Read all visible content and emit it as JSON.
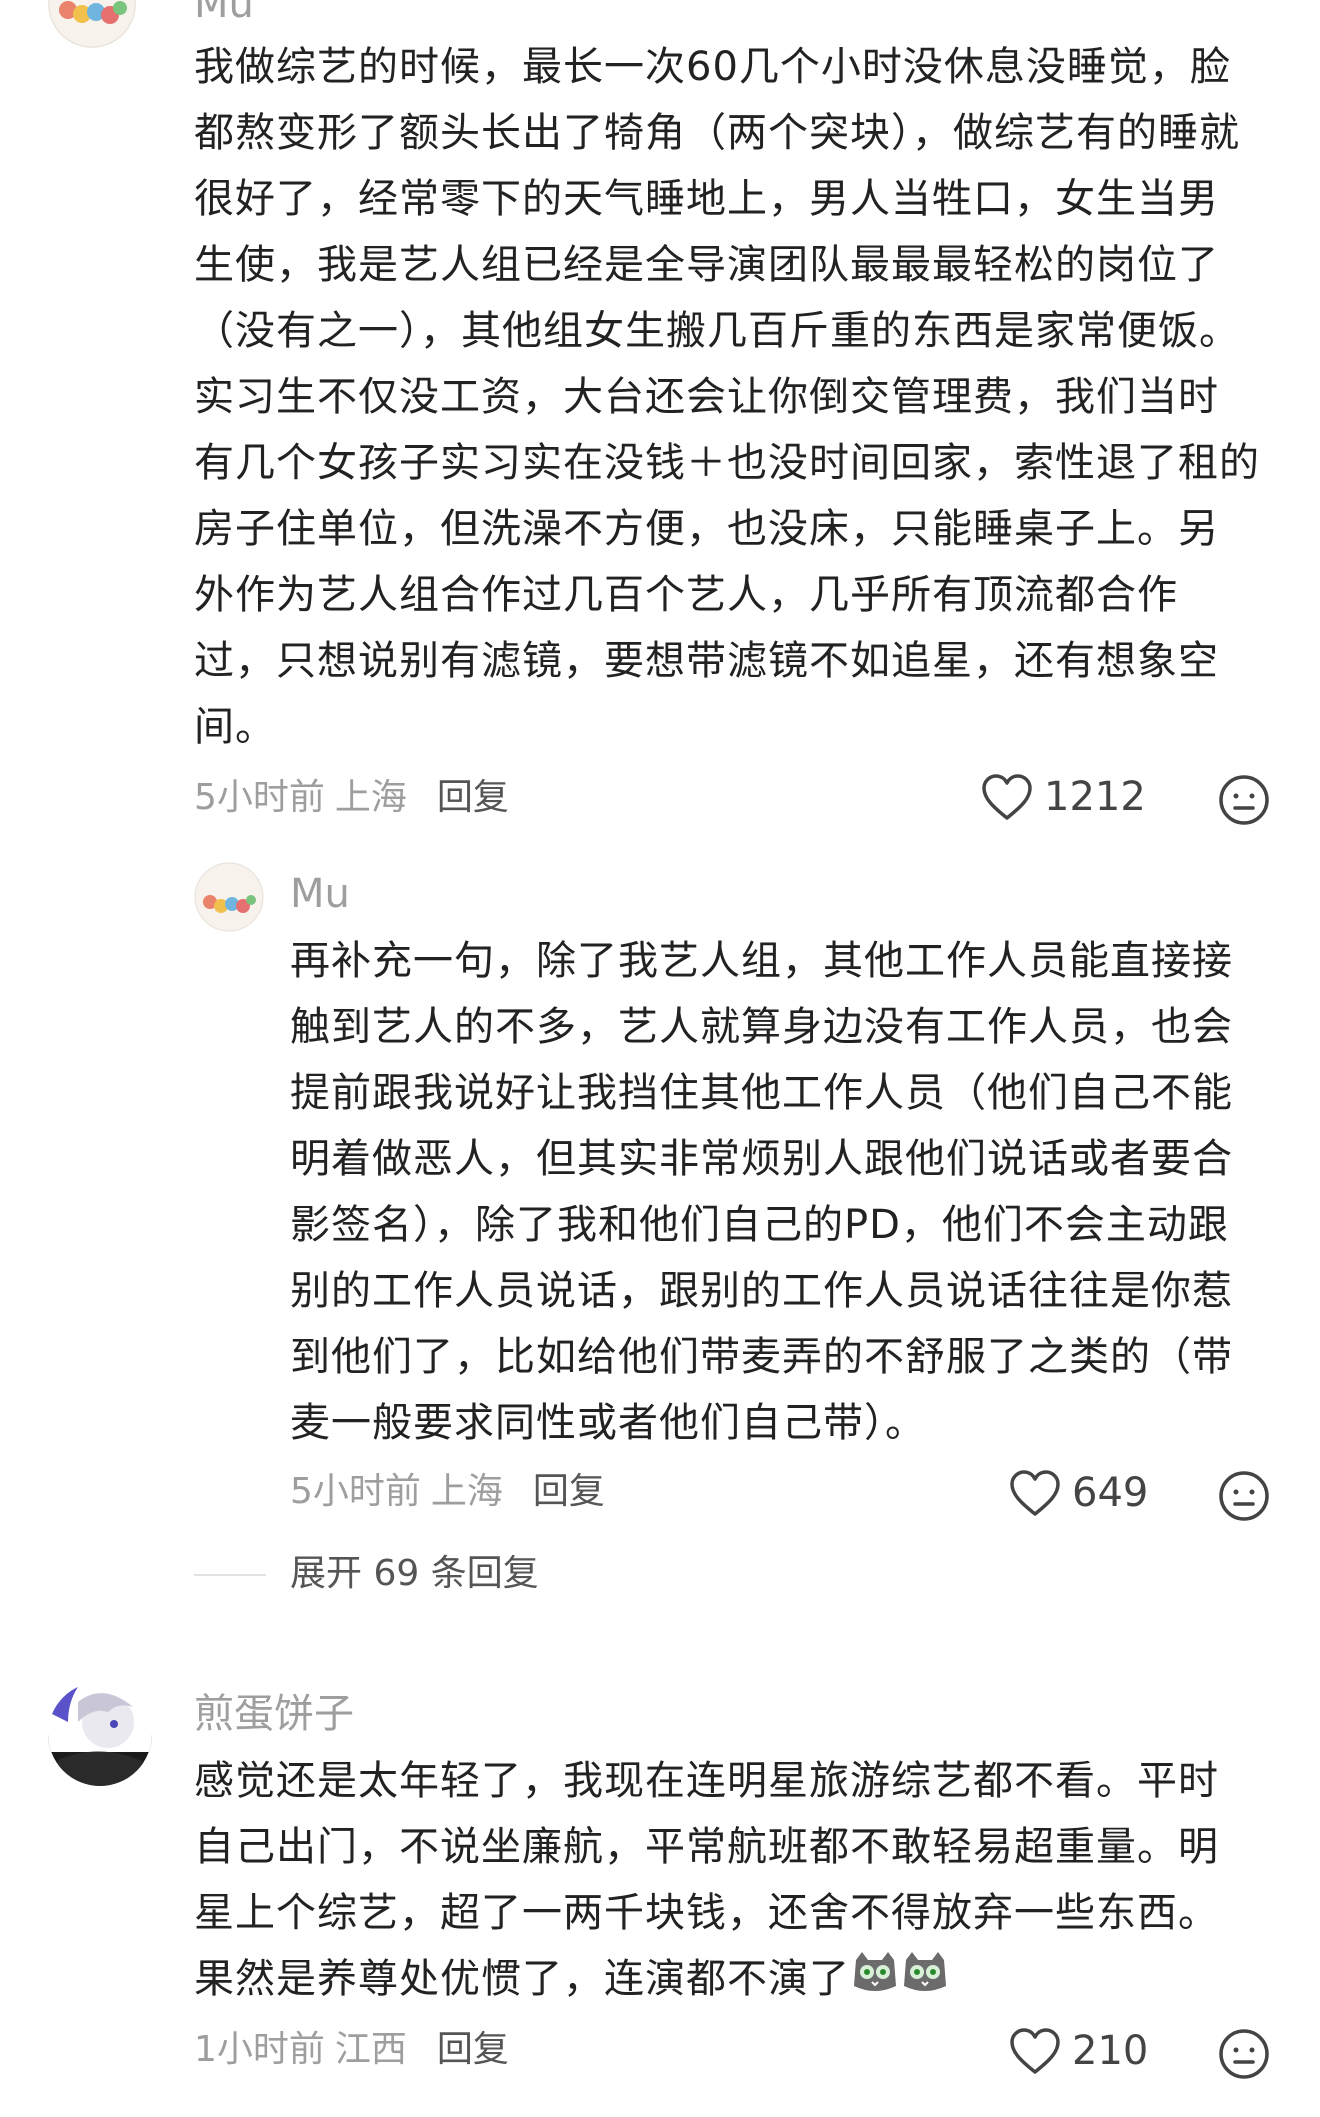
{
  "comments": [
    {
      "username": "Mu",
      "content": "我做综艺的时候，最长一次60几个小时没休息没睡觉，脸\n都熬变形了额头长出了犄角（两个突块），做综艺有的睡就\n很好了，经常零下的天气睡地上，男人当牲口，女生当男\n生使，我是艺人组已经是全导演团队最最最轻松的岗位了\n（没有之一），其他组女生搬几百斤重的东西是家常便饭。\n实习生不仅没工资，大台还会让你倒交管理费，我们当时\n有几个女孩子实习实在没钱＋也没时间回家，索性退了租的\n房子住单位，但洗澡不方便，也没床，只能睡桌子上。另\n外作为艺人组合作过几百个艺人，几乎所有顶流都合作\n过，只想说别有滤镜，要想带滤镜不如追星，还有想象空\n间。",
      "time": "5小时前",
      "location": "上海",
      "reply_label": "回复",
      "likes": "1212"
    },
    {
      "username": "Mu",
      "content": "再补充一句，除了我艺人组，其他工作人员能直接接\n触到艺人的不多，艺人就算身边没有工作人员，也会\n提前跟我说好让我挡住其他工作人员（他们自己不能\n明着做恶人，但其实非常烦别人跟他们说话或者要合\n影签名），除了我和他们自己的PD，他们不会主动跟\n别的工作人员说话，跟别的工作人员说话往往是你惹\n到他们了，比如给他们带麦弄的不舒服了之类的（带\n麦一般要求同性或者他们自己带）。",
      "time": "5小时前",
      "location": "上海",
      "reply_label": "回复",
      "likes": "649"
    },
    {
      "username": "煎蛋饼子",
      "content": "感觉还是太年轻了，我现在连明星旅游综艺都不看。平时\n自己出门，不说坐廉航，平常航班都不敢轻易超重量。明\n星上个综艺，超了一两千块钱，还舍不得放弃一些东西。\n果然是养尊处优惯了，连演都不演了",
      "time": "1小时前",
      "location": "江西",
      "reply_label": "回复",
      "likes": "210"
    }
  ],
  "expand_replies": "展开 69 条回复",
  "icons": {
    "like": "heart-outline-icon",
    "emoji": "neutral-face-icon",
    "inline_emoji": "cat-emoji-icon"
  },
  "colors": {
    "meta_gray": "#9e9e9e",
    "text": "#222222"
  }
}
